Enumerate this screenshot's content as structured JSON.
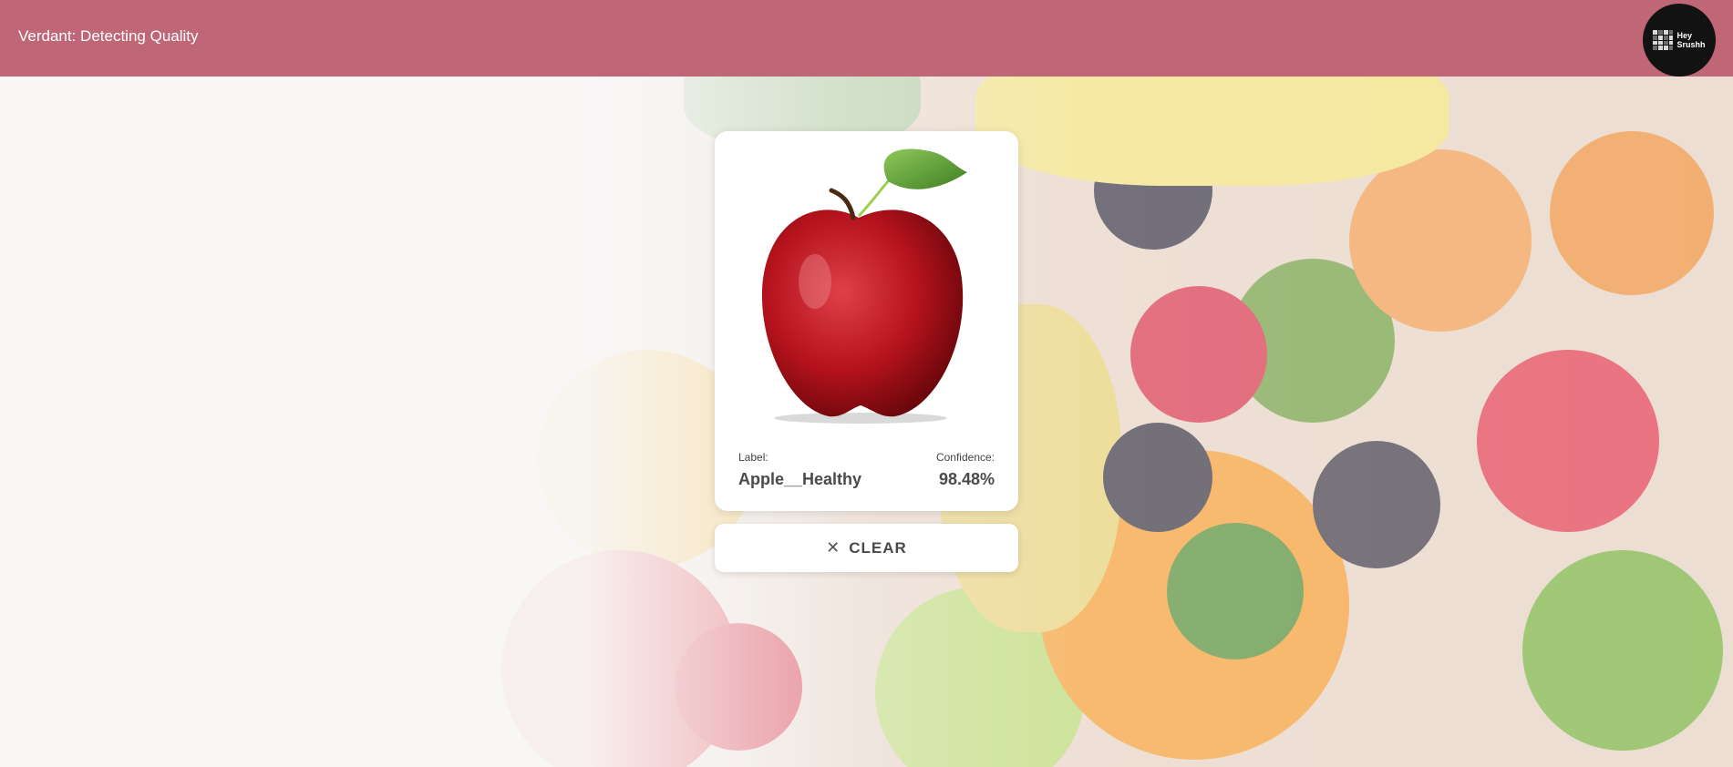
{
  "header": {
    "title": "Verdant: Detecting Quality",
    "avatar_text_line1": "Hey",
    "avatar_text_line2": "Srushh"
  },
  "result": {
    "image_icon": "red-apple-image",
    "label_caption": "Label:",
    "label_value": "Apple__Healthy",
    "confidence_caption": "Confidence:",
    "confidence_value": "98.48%"
  },
  "actions": {
    "clear_icon": "close-icon",
    "clear_glyph": "✕",
    "clear_label": "CLEAR"
  },
  "colors": {
    "header_bg": "#bf6776",
    "card_bg": "#ffffff",
    "text_dark": "#4a4a4a"
  }
}
